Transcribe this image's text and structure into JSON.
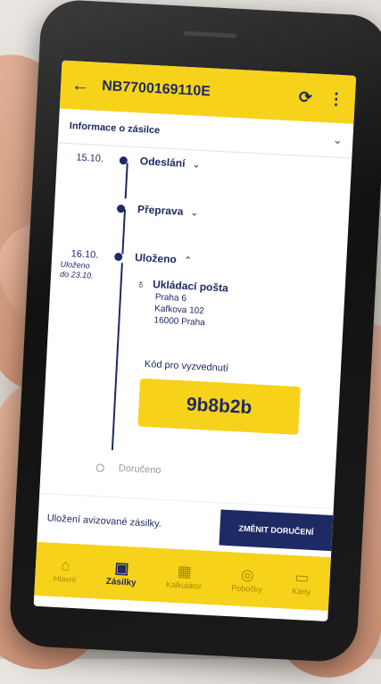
{
  "header": {
    "title": "NB7700169110E",
    "back_icon": "←",
    "refresh_icon": "⟳",
    "more_icon": "⋮"
  },
  "section": {
    "title": "Informace o zásilce"
  },
  "timeline": [
    {
      "date": "15.10.",
      "label": "Odeslání",
      "state": "collapsed"
    },
    {
      "date": "",
      "label": "Přeprava",
      "state": "collapsed"
    },
    {
      "date": "16.10.",
      "label": "Uloženo",
      "state": "expanded"
    }
  ],
  "stored_note": {
    "line1": "Uloženo",
    "line2": "do 23.10."
  },
  "post_office": {
    "name": "Ukládací pošta",
    "line1": "Praha 6",
    "line2": "Kafkova 102",
    "line3": "16000 Praha"
  },
  "pickup": {
    "label": "Kód pro vyzvednutí",
    "code": "9b8b2b"
  },
  "delivered_label": "Doručeno",
  "bottom": {
    "message": "Uložení avizované zásilky.",
    "button": "ZMĚNIT DORUČENÍ"
  },
  "tabs": [
    {
      "label": "Hlavní",
      "icon": "home-icon"
    },
    {
      "label": "Zásilky",
      "icon": "package-icon"
    },
    {
      "label": "Kalkulátor",
      "icon": "calculator-icon"
    },
    {
      "label": "Pobočky",
      "icon": "location-search-icon"
    },
    {
      "label": "Karty",
      "icon": "card-icon"
    }
  ],
  "colors": {
    "brand_yellow": "#f7d21b",
    "brand_blue": "#1e2a63"
  }
}
